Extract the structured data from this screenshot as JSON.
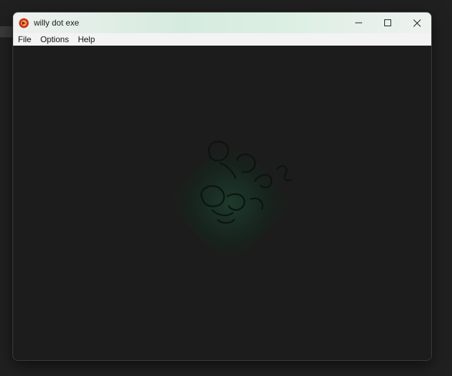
{
  "window": {
    "title": "willy dot exe",
    "icon": "red-circle-app-icon"
  },
  "controls": {
    "minimize_icon": "minimize-icon",
    "maximize_icon": "maximize-icon",
    "close_icon": "close-icon"
  },
  "menu": {
    "items": [
      "File",
      "Options",
      "Help"
    ]
  },
  "canvas": {
    "background": "#1c1c1c",
    "image": "dark-diamond-character-sketch"
  },
  "colors": {
    "titlebar_tint": "#d6ebdf",
    "icon_red": "#c9311d"
  }
}
